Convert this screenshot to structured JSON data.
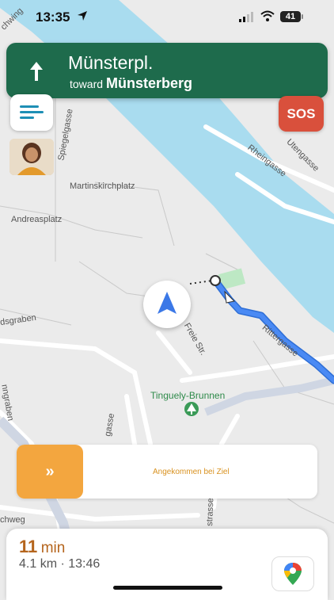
{
  "status_bar": {
    "time": "13:35",
    "battery": "41"
  },
  "nav_banner": {
    "street": "Münsterpl.",
    "toward_prefix": "toward",
    "destination": "Münsterberg"
  },
  "sos_label": "SOS",
  "map_labels": {
    "martinskirchplatz": "Martinskirchplatz",
    "andreasplatz": "Andreasplatz",
    "tinguely": "Tinguely-Brunnen",
    "rheingasse": "Rheingasse",
    "utengasse": "Utengasse",
    "spiegelgasse": "Spiegelgasse",
    "freie_str": "Freie Str.",
    "rittergasse": "Rittergasse",
    "sdsgraben": "dsgraben",
    "nngraben": "nngraben",
    "chweg": "chweg",
    "gasse_left": "gasse",
    "strasse_bottom": "strasse",
    "schwing": "chwing"
  },
  "arrival": {
    "button_label": "»",
    "text": "Angekommen bei Ziel"
  },
  "eta": {
    "minutes": "11",
    "unit": "min",
    "details": "4.1 km · 13:46"
  },
  "colors": {
    "banner": "#1e6b4c",
    "sos": "#d9503c",
    "river": "#a9dcef",
    "route": "#4a8af4",
    "arrive_button": "#f3a63f",
    "eta_text": "#b5651d"
  }
}
